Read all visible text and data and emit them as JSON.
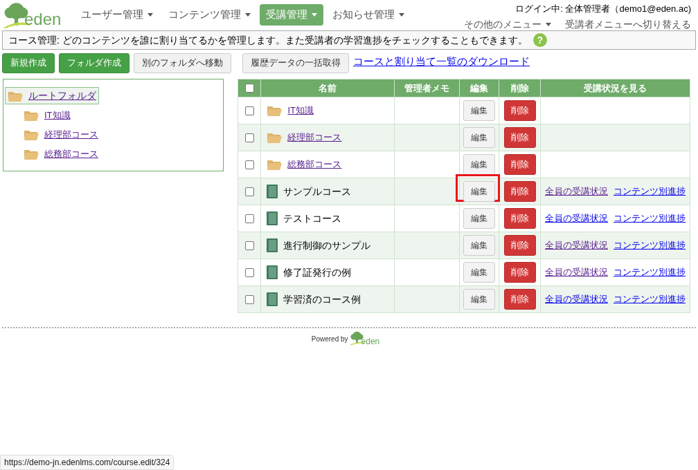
{
  "logo": {
    "text": "eden"
  },
  "nav": [
    {
      "label": "ユーザー管理",
      "selected": false
    },
    {
      "label": "コンテンツ管理",
      "selected": false
    },
    {
      "label": "受講管理",
      "selected": true
    },
    {
      "label": "お知らせ管理",
      "selected": false
    }
  ],
  "login": "ログイン中: 全体管理者（demo1@eden.ac)",
  "other_menu": "その他のメニュー",
  "switch_menu": "受講者メニューへ切り替える",
  "info": "コース管理: どのコンテンツを誰に割り当てるかを管理します。また受講者の学習進捗をチェックすることもできます。",
  "help": "?",
  "toolbar": [
    {
      "label": "新規作成",
      "kind": "primary"
    },
    {
      "label": "フォルダ作成",
      "kind": "primary"
    },
    {
      "label": "別のフォルダへ移動",
      "kind": "default"
    },
    {
      "label": "履歴データの一括取得",
      "kind": "default"
    }
  ],
  "download_link": {
    "label": "コースと割り当て一覧のダウンロード",
    "visited": false
  },
  "tree": {
    "label": "ルートフォルダ",
    "selected": true,
    "children": [
      {
        "label": "IT知識"
      },
      {
        "label": "経理部コース"
      },
      {
        "label": "総務部コース"
      }
    ]
  },
  "table": {
    "columns": [
      "名前",
      "管理者メモ",
      "編集",
      "削除",
      "受講状況を見る"
    ],
    "header_checked": false,
    "rows": [
      {
        "kind": "folder",
        "name": "IT知識",
        "checked": false,
        "highlighted": false,
        "edit": "編集",
        "delete": "削除"
      },
      {
        "kind": "folder",
        "name": "経理部コース",
        "checked": false,
        "highlighted": false,
        "edit": "編集",
        "delete": "削除"
      },
      {
        "kind": "folder",
        "name": "総務部コース",
        "checked": false,
        "highlighted": false,
        "edit": "編集",
        "delete": "削除"
      },
      {
        "kind": "course",
        "name": "サンプルコース",
        "checked": false,
        "highlighted": true,
        "edit": "編集",
        "delete": "削除",
        "links": [
          {
            "label": "全員の受講状況",
            "visited": true
          },
          {
            "label": "コンテンツ別進捗",
            "visited": false
          }
        ]
      },
      {
        "kind": "course",
        "name": "テストコース",
        "checked": false,
        "highlighted": false,
        "edit": "編集",
        "delete": "削除",
        "links": [
          {
            "label": "全員の受講状況",
            "visited": false
          },
          {
            "label": "コンテンツ別進捗",
            "visited": false
          }
        ]
      },
      {
        "kind": "course",
        "name": "進行制御のサンプル",
        "checked": false,
        "highlighted": false,
        "edit": "編集",
        "delete": "削除",
        "links": [
          {
            "label": "全員の受講状況",
            "visited": true
          },
          {
            "label": "コンテンツ別進捗",
            "visited": false
          }
        ]
      },
      {
        "kind": "course",
        "name": "修了証発行の例",
        "checked": false,
        "highlighted": false,
        "edit": "編集",
        "delete": "削除",
        "links": [
          {
            "label": "全員の受講状況",
            "visited": true
          },
          {
            "label": "コンテンツ別進捗",
            "visited": false
          }
        ]
      },
      {
        "kind": "course",
        "name": "学習済のコース例",
        "checked": false,
        "highlighted": false,
        "edit": "編集",
        "delete": "削除",
        "links": [
          {
            "label": "全員の受講状況",
            "visited": false
          },
          {
            "label": "コンテンツ別進捗",
            "visited": false
          }
        ]
      }
    ]
  },
  "footer": {
    "powered_by": "Powered by",
    "logo_text": "eden"
  },
  "status_url": "https://demo-jn.edenlms.com/course.edit/324"
}
